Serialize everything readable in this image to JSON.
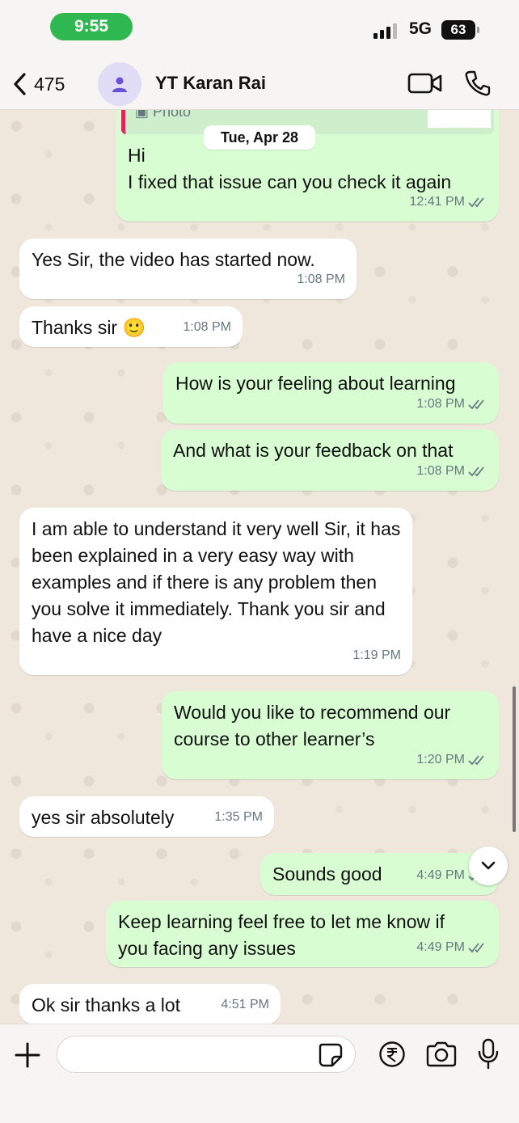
{
  "status_bar": {
    "time": "9:55",
    "network": "5G",
    "battery": "63"
  },
  "header": {
    "back_count": "475",
    "contact_name": "YT Karan Rai"
  },
  "chat": {
    "reply_label": "Photo",
    "date_chip": "Tue, Apr 28",
    "messages": [
      {
        "dir": "out",
        "text": "Hi\nI fixed that issue can you check it again",
        "time": "12:41 PM"
      },
      {
        "dir": "in",
        "text": "Yes Sir, the video has started now.",
        "time": "1:08 PM"
      },
      {
        "dir": "in",
        "text": "Thanks sir 🙂",
        "time": "1:08 PM"
      },
      {
        "dir": "out",
        "text": "How is your feeling about learning",
        "time": "1:08 PM"
      },
      {
        "dir": "out",
        "text": "And what is your feedback on that",
        "time": "1:08 PM"
      },
      {
        "dir": "in",
        "text": "I am able to understand it very well Sir, it has been explained in a very easy way with examples and if there is any problem then you solve it immediately. Thank you sir and have a nice day",
        "time": "1:19 PM"
      },
      {
        "dir": "out",
        "text": "Would you like to recommend our course to other learner’s",
        "time": "1:20 PM"
      },
      {
        "dir": "in",
        "text": "yes sir absolutely",
        "time": "1:35 PM"
      },
      {
        "dir": "out",
        "text": "Sounds good",
        "time": "4:49 PM"
      },
      {
        "dir": "out",
        "text": "Keep learning feel free to let me know if you facing any issues",
        "time": "4:49 PM"
      },
      {
        "dir": "in",
        "text": "Ok sir thanks a lot",
        "time": "4:51 PM"
      }
    ]
  },
  "input": {
    "value": "",
    "placeholder": ""
  },
  "icons": {
    "back": "chevron-left-icon",
    "avatar": "person-icon",
    "video": "video-camera-icon",
    "call": "phone-icon",
    "scroll": "chevron-down-icon",
    "plus": "plus-icon",
    "sticker": "sticker-icon",
    "payment": "rupee-icon",
    "camera": "camera-icon",
    "mic": "microphone-icon"
  },
  "colors": {
    "outgoing": "#d9fdd3",
    "incoming": "#ffffff",
    "time_pill": "#2fb84f",
    "avatar_bg": "#e2ddf7",
    "ticks": "#667781"
  }
}
